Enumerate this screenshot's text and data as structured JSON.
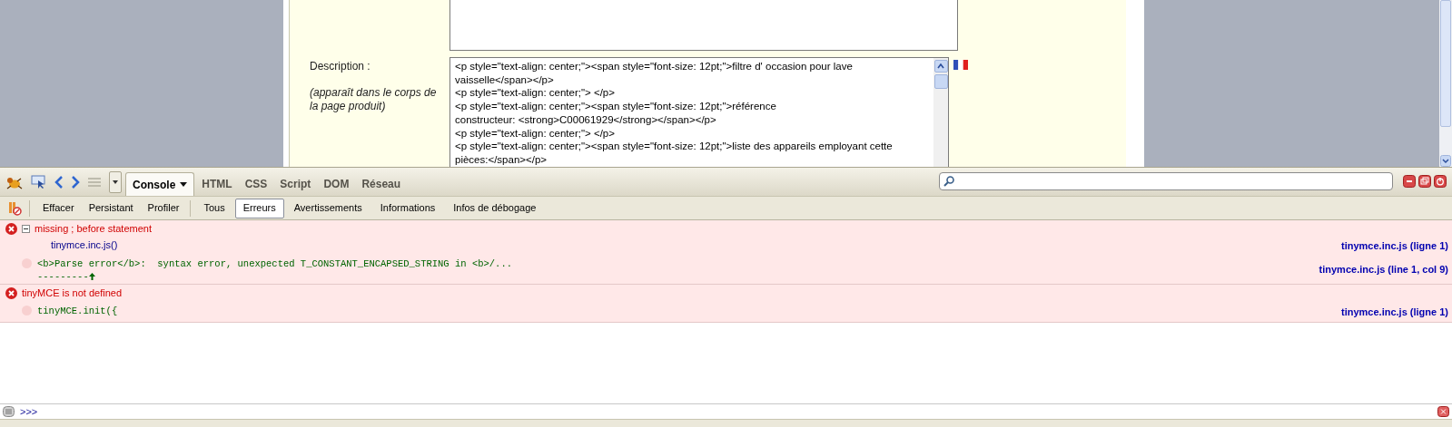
{
  "page": {
    "description_label": "Description :",
    "description_note": "(apparaît dans le corps de la page produit)",
    "description_lines": [
      "<p style=\"text-align: center;\"><span style=\"font-size: 12pt;\">filtre d' occasion pour lave",
      "vaisselle</span></p>",
      "<p style=\"text-align: center;\"> </p>",
      "<p style=\"text-align: center;\"><span style=\"font-size: 12pt;\">référence",
      "constructeur: <strong>C00061929</strong></span></p>",
      "<p style=\"text-align: center;\"> </p>",
      "<p style=\"text-align: center;\"><span style=\"font-size: 12pt;\">liste des appareils employant cette",
      "pièces:</span></p>"
    ]
  },
  "toolbar": {
    "tabs": [
      {
        "label": "Console",
        "selected": true
      },
      {
        "label": "HTML",
        "selected": false
      },
      {
        "label": "CSS",
        "selected": false
      },
      {
        "label": "Script",
        "selected": false
      },
      {
        "label": "DOM",
        "selected": false
      },
      {
        "label": "Réseau",
        "selected": false
      }
    ]
  },
  "filter_bar": {
    "buttons": [
      "Effacer",
      "Persistant",
      "Profiler"
    ],
    "filters": [
      {
        "label": "Tous",
        "selected": false
      },
      {
        "label": "Erreurs",
        "selected": true
      },
      {
        "label": "Avertissements",
        "selected": false
      },
      {
        "label": "Informations",
        "selected": false
      },
      {
        "label": "Infos de débogage",
        "selected": false
      }
    ]
  },
  "messages": [
    {
      "text": "missing ; before statement",
      "expanded": true,
      "children": [
        {
          "kind": "stack",
          "text": "tinymce.inc.js()",
          "source": "tinymce.inc.js (ligne 1)"
        },
        {
          "kind": "code",
          "text": "<b>Parse error</b>:  syntax error, unexpected T_CONSTANT_ENCAPSED_STRING in <b>/...",
          "pointer": "---------",
          "source": "tinymce.inc.js (line 1, col 9)"
        }
      ]
    },
    {
      "text": "tinyMCE is not defined",
      "children": [
        {
          "kind": "code",
          "text": "tinyMCE.init({",
          "source": "tinymce.inc.js (ligne 1)"
        }
      ]
    }
  ],
  "command_line": {
    "prompt": ">>>"
  }
}
